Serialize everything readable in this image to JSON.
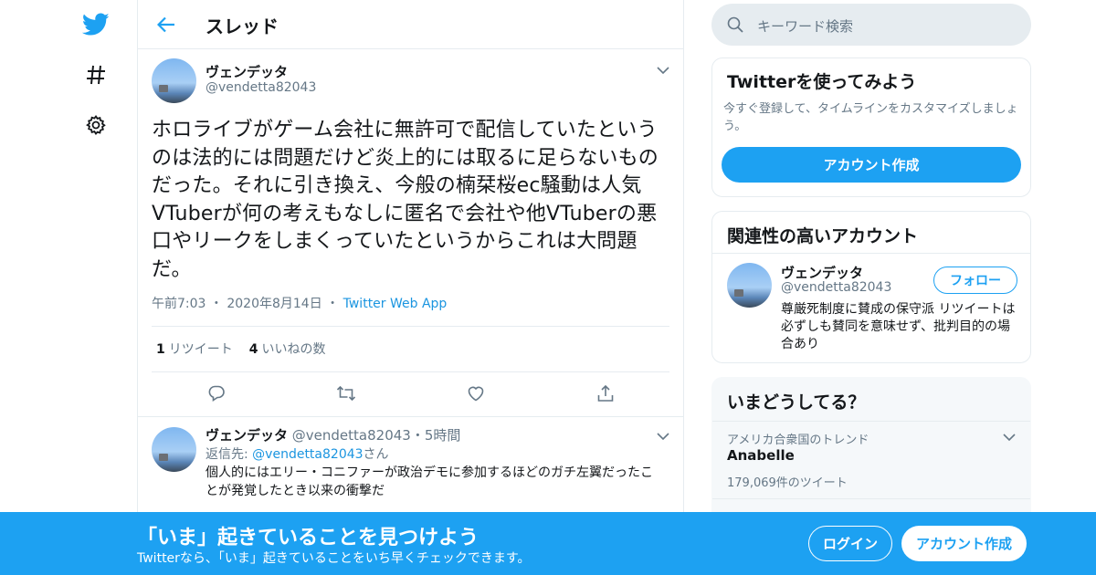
{
  "colors": {
    "accent": "#1da1f2",
    "text": "#14171a",
    "secondary": "#657786",
    "border": "#e6ecf0"
  },
  "nav": {
    "icons": [
      "twitter-logo",
      "hashtag-icon",
      "gear-icon"
    ]
  },
  "header": {
    "title": "スレッド"
  },
  "tweet": {
    "name": "ヴェンデッタ",
    "handle": "@vendetta82043",
    "text": "ホロライブがゲーム会社に無許可で配信していたというのは法的には問題だけど炎上的には取るに足らないものだった。それに引き換え、今般の楠栞桜ec騒動は人気VTuberが何の考えもなしに匿名で会社や他VTuberの悪口やリークをしまくっていたというからこれは大問題だ。",
    "time": "午前7:03",
    "date": "2020年8月14日",
    "dot": "・",
    "via": "Twitter Web App",
    "retweets": "1",
    "retweets_label": "リツイート",
    "likes": "4",
    "likes_label": "いいねの数"
  },
  "reply": {
    "name": "ヴェンデッタ",
    "handle": "@vendetta82043",
    "dot": "・",
    "age": "5時間",
    "replyto_prefix": "返信先: ",
    "replyto_handle": "@vendetta82043",
    "replyto_suffix": "さん",
    "text": "個人的にはエリー・コニファーが政治デモに参加するほどのガチ左翼だったことが発覚したとき以来の衝撃だ"
  },
  "search": {
    "placeholder": "キーワード検索"
  },
  "signup_card": {
    "title": "Twitterを使ってみよう",
    "desc": "今すぐ登録して、タイムラインをカスタマイズしましょう。",
    "button": "アカウント作成"
  },
  "related": {
    "title": "関連性の高いアカウント",
    "name": "ヴェンデッタ",
    "handle": "@vendetta82043",
    "follow": "フォロー",
    "bio": "尊厳死制度に賛成の保守派 リツイートは必ずしも賛同を意味せず、批判目的の場合あり"
  },
  "trends": {
    "title": "いまどうしてる？",
    "context": "アメリカ合衆国のトレンド",
    "trend": "Anabelle",
    "count": "179,069件のツイート"
  },
  "banner": {
    "title": "「いま」起きていることを見つけよう",
    "subtitle": "Twitterなら、「いま」起きていることをいち早くチェックできます。",
    "login": "ログイン",
    "signup": "アカウント作成"
  }
}
